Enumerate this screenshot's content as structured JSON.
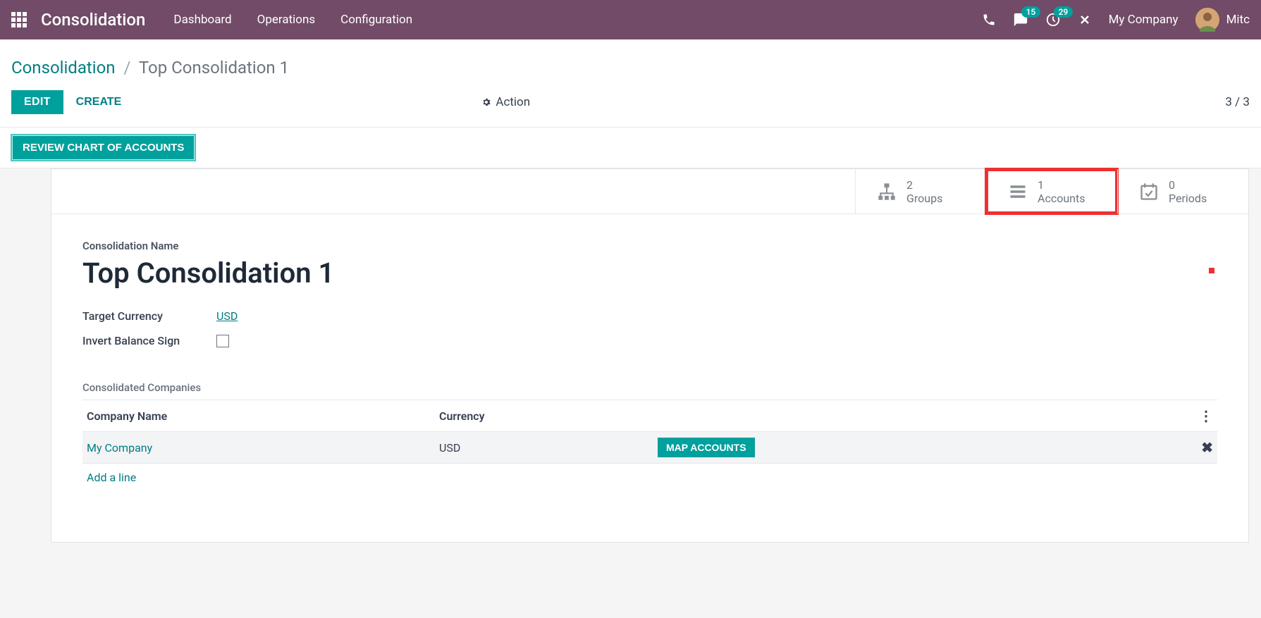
{
  "topnav": {
    "app_title": "Consolidation",
    "links": [
      "Dashboard",
      "Operations",
      "Configuration"
    ],
    "msg_badge": "15",
    "activity_badge": "29",
    "company": "My Company",
    "user_trunc": "Mitc"
  },
  "breadcrumb": {
    "root": "Consolidation",
    "current": "Top Consolidation 1"
  },
  "controls": {
    "edit": "EDIT",
    "create": "CREATE",
    "action": "Action",
    "pager": "3 / 3"
  },
  "statusbar": {
    "review": "REVIEW CHART OF ACCOUNTS"
  },
  "stats": {
    "groups": {
      "count": "2",
      "label": "Groups"
    },
    "accounts": {
      "count": "1",
      "label": "Accounts"
    },
    "periods": {
      "count": "0",
      "label": "Periods"
    }
  },
  "form": {
    "name_label": "Consolidation Name",
    "name_value": "Top Consolidation 1",
    "currency_label": "Target Currency",
    "currency_value": "USD",
    "invert_label": "Invert Balance Sign",
    "section_title": "Consolidated Companies",
    "cols": {
      "company": "Company Name",
      "currency": "Currency"
    },
    "row": {
      "company": "My Company",
      "currency": "USD",
      "map": "MAP ACCOUNTS"
    },
    "add_line": "Add a line"
  }
}
